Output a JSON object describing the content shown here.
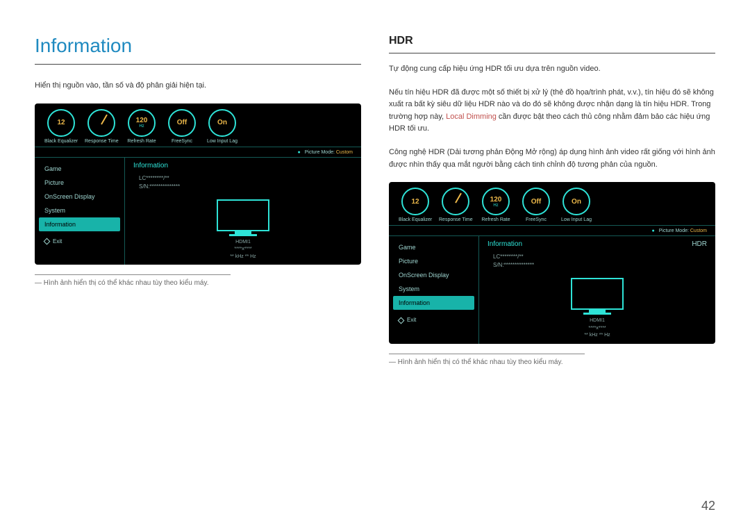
{
  "page_number": "42",
  "left": {
    "title": "Information",
    "desc": "Hiển thị nguồn vào, tần số và độ phân giải hiện tại.",
    "footnote": "― Hình ảnh hiển thị có thể khác nhau tùy theo kiểu máy."
  },
  "right": {
    "title": "HDR",
    "desc_1": "Tự động cung cấp hiệu ứng HDR tối ưu dựa trên nguồn video.",
    "desc_2a": "Nếu tín hiệu HDR đã được một số thiết bị xử lý (thẻ đồ họa/trình phát, v.v.), tín hiệu đó sẽ không xuất ra bất kỳ siêu dữ liệu HDR nào và do đó sẽ không được nhận dạng là tín hiệu HDR. Trong trường hợp này, ",
    "desc_2_highlight": "Local Dimming",
    "desc_2b": " cần được bật theo cách thủ công nhằm đảm bảo các hiệu ứng HDR tối ưu.",
    "desc_3": "Công nghệ HDR (Dải tương phản Động Mở rộng) áp dụng hình ảnh video rất giống với hình ảnh được nhìn thấy qua mắt người bằng cách tinh chỉnh độ tương phản của nguồn.",
    "footnote": "― Hình ảnh hiển thị có thể khác nhau tùy theo kiểu máy."
  },
  "osd": {
    "dials": [
      {
        "value": "12",
        "unit": "",
        "label": "Black Equalizer"
      },
      {
        "value": "",
        "unit": "",
        "label": "Response Time",
        "gauge": true
      },
      {
        "value": "120",
        "unit": "Hz",
        "label": "Refresh Rate"
      },
      {
        "value": "Off",
        "unit": "",
        "label": "FreeSync"
      },
      {
        "value": "On",
        "unit": "",
        "label": "Low Input Lag"
      }
    ],
    "picture_mode_label": "Picture Mode:",
    "picture_mode_value": "Custom",
    "menu": [
      "Game",
      "Picture",
      "OnScreen Display",
      "System",
      "Information"
    ],
    "active_menu_index": 4,
    "exit": "Exit",
    "content_title": "Information",
    "hdr_label": "HDR",
    "info_lines": [
      "LC********/**",
      "S/N:**************"
    ],
    "monitor": {
      "source": "HDMI1",
      "res": "****x****",
      "freq": "** kHz ** Hz"
    }
  }
}
